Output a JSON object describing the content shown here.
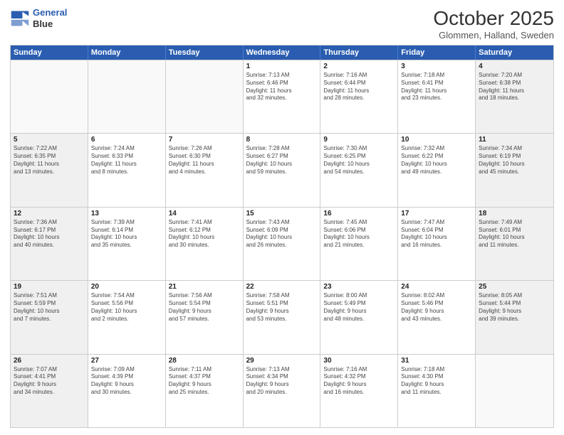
{
  "header": {
    "logo_line1": "General",
    "logo_line2": "Blue",
    "month": "October 2025",
    "location": "Glommen, Halland, Sweden"
  },
  "weekdays": [
    "Sunday",
    "Monday",
    "Tuesday",
    "Wednesday",
    "Thursday",
    "Friday",
    "Saturday"
  ],
  "rows": [
    [
      {
        "day": "",
        "info": ""
      },
      {
        "day": "",
        "info": ""
      },
      {
        "day": "",
        "info": ""
      },
      {
        "day": "1",
        "info": "Sunrise: 7:13 AM\nSunset: 6:46 PM\nDaylight: 11 hours\nand 32 minutes."
      },
      {
        "day": "2",
        "info": "Sunrise: 7:16 AM\nSunset: 6:44 PM\nDaylight: 11 hours\nand 28 minutes."
      },
      {
        "day": "3",
        "info": "Sunrise: 7:18 AM\nSunset: 6:41 PM\nDaylight: 11 hours\nand 23 minutes."
      },
      {
        "day": "4",
        "info": "Sunrise: 7:20 AM\nSunset: 6:38 PM\nDaylight: 11 hours\nand 18 minutes."
      }
    ],
    [
      {
        "day": "5",
        "info": "Sunrise: 7:22 AM\nSunset: 6:35 PM\nDaylight: 11 hours\nand 13 minutes."
      },
      {
        "day": "6",
        "info": "Sunrise: 7:24 AM\nSunset: 6:33 PM\nDaylight: 11 hours\nand 8 minutes."
      },
      {
        "day": "7",
        "info": "Sunrise: 7:26 AM\nSunset: 6:30 PM\nDaylight: 11 hours\nand 4 minutes."
      },
      {
        "day": "8",
        "info": "Sunrise: 7:28 AM\nSunset: 6:27 PM\nDaylight: 10 hours\nand 59 minutes."
      },
      {
        "day": "9",
        "info": "Sunrise: 7:30 AM\nSunset: 6:25 PM\nDaylight: 10 hours\nand 54 minutes."
      },
      {
        "day": "10",
        "info": "Sunrise: 7:32 AM\nSunset: 6:22 PM\nDaylight: 10 hours\nand 49 minutes."
      },
      {
        "day": "11",
        "info": "Sunrise: 7:34 AM\nSunset: 6:19 PM\nDaylight: 10 hours\nand 45 minutes."
      }
    ],
    [
      {
        "day": "12",
        "info": "Sunrise: 7:36 AM\nSunset: 6:17 PM\nDaylight: 10 hours\nand 40 minutes."
      },
      {
        "day": "13",
        "info": "Sunrise: 7:39 AM\nSunset: 6:14 PM\nDaylight: 10 hours\nand 35 minutes."
      },
      {
        "day": "14",
        "info": "Sunrise: 7:41 AM\nSunset: 6:12 PM\nDaylight: 10 hours\nand 30 minutes."
      },
      {
        "day": "15",
        "info": "Sunrise: 7:43 AM\nSunset: 6:09 PM\nDaylight: 10 hours\nand 26 minutes."
      },
      {
        "day": "16",
        "info": "Sunrise: 7:45 AM\nSunset: 6:06 PM\nDaylight: 10 hours\nand 21 minutes."
      },
      {
        "day": "17",
        "info": "Sunrise: 7:47 AM\nSunset: 6:04 PM\nDaylight: 10 hours\nand 16 minutes."
      },
      {
        "day": "18",
        "info": "Sunrise: 7:49 AM\nSunset: 6:01 PM\nDaylight: 10 hours\nand 11 minutes."
      }
    ],
    [
      {
        "day": "19",
        "info": "Sunrise: 7:51 AM\nSunset: 5:59 PM\nDaylight: 10 hours\nand 7 minutes."
      },
      {
        "day": "20",
        "info": "Sunrise: 7:54 AM\nSunset: 5:56 PM\nDaylight: 10 hours\nand 2 minutes."
      },
      {
        "day": "21",
        "info": "Sunrise: 7:56 AM\nSunset: 5:54 PM\nDaylight: 9 hours\nand 57 minutes."
      },
      {
        "day": "22",
        "info": "Sunrise: 7:58 AM\nSunset: 5:51 PM\nDaylight: 9 hours\nand 53 minutes."
      },
      {
        "day": "23",
        "info": "Sunrise: 8:00 AM\nSunset: 5:49 PM\nDaylight: 9 hours\nand 48 minutes."
      },
      {
        "day": "24",
        "info": "Sunrise: 8:02 AM\nSunset: 5:46 PM\nDaylight: 9 hours\nand 43 minutes."
      },
      {
        "day": "25",
        "info": "Sunrise: 8:05 AM\nSunset: 5:44 PM\nDaylight: 9 hours\nand 39 minutes."
      }
    ],
    [
      {
        "day": "26",
        "info": "Sunrise: 7:07 AM\nSunset: 4:41 PM\nDaylight: 9 hours\nand 34 minutes."
      },
      {
        "day": "27",
        "info": "Sunrise: 7:09 AM\nSunset: 4:39 PM\nDaylight: 9 hours\nand 30 minutes."
      },
      {
        "day": "28",
        "info": "Sunrise: 7:11 AM\nSunset: 4:37 PM\nDaylight: 9 hours\nand 25 minutes."
      },
      {
        "day": "29",
        "info": "Sunrise: 7:13 AM\nSunset: 4:34 PM\nDaylight: 9 hours\nand 20 minutes."
      },
      {
        "day": "30",
        "info": "Sunrise: 7:16 AM\nSunset: 4:32 PM\nDaylight: 9 hours\nand 16 minutes."
      },
      {
        "day": "31",
        "info": "Sunrise: 7:18 AM\nSunset: 4:30 PM\nDaylight: 9 hours\nand 11 minutes."
      },
      {
        "day": "",
        "info": ""
      }
    ]
  ]
}
